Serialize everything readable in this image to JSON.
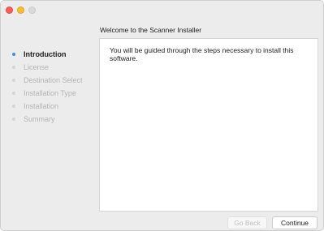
{
  "window": {
    "title": "Welcome to the Scanner Installer",
    "controls": [
      "close-icon",
      "minimize-icon",
      "zoom-icon"
    ]
  },
  "sidebar": {
    "steps": [
      {
        "label": "Introduction",
        "active": true
      },
      {
        "label": "License",
        "active": false
      },
      {
        "label": "Destination Select",
        "active": false
      },
      {
        "label": "Installation Type",
        "active": false
      },
      {
        "label": "Installation",
        "active": false
      },
      {
        "label": "Summary",
        "active": false
      }
    ]
  },
  "content": {
    "text": "You will be guided through the steps necessary to install this software."
  },
  "buttons": {
    "go_back": {
      "label": "Go Back",
      "enabled": false
    },
    "continue": {
      "label": "Continue",
      "enabled": true
    }
  },
  "colors": {
    "active_bullet": "#3d8ef5",
    "close": "#fc5f57",
    "minimize": "#fdbc2e"
  }
}
